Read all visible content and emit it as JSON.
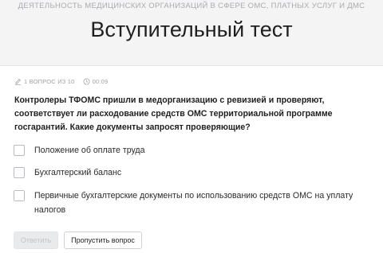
{
  "header": {
    "course_title": "Деятельность медицинских организаций в сфере ОМС, платных услуг и ДМС",
    "page_title": "Вступительный тест",
    "background": "#f4f4f5"
  },
  "meta": {
    "pen_icon": "pen-icon",
    "question_counter": "1 вопрос из 10",
    "clock_icon": "clock-icon",
    "timer": "00:09"
  },
  "question": {
    "text": "Контролеры ТФОМС пришли в медорганизацию с ревизией и проверяют, соответствует ли расходование средств ОМС территориальной программе госгарантий. Какие документы запросят проверяющие?"
  },
  "options": [
    {
      "label": "Положение об оплате труда",
      "checked": false
    },
    {
      "label": "Бухгалтерский баланс",
      "checked": false
    },
    {
      "label": "Первичные бухгалтерские документы по использованию средств ОМС на уплату налогов",
      "checked": false
    }
  ],
  "buttons": {
    "answer_label": "Ответить",
    "answer_disabled": true,
    "skip_label": "Пропустить вопрос"
  }
}
